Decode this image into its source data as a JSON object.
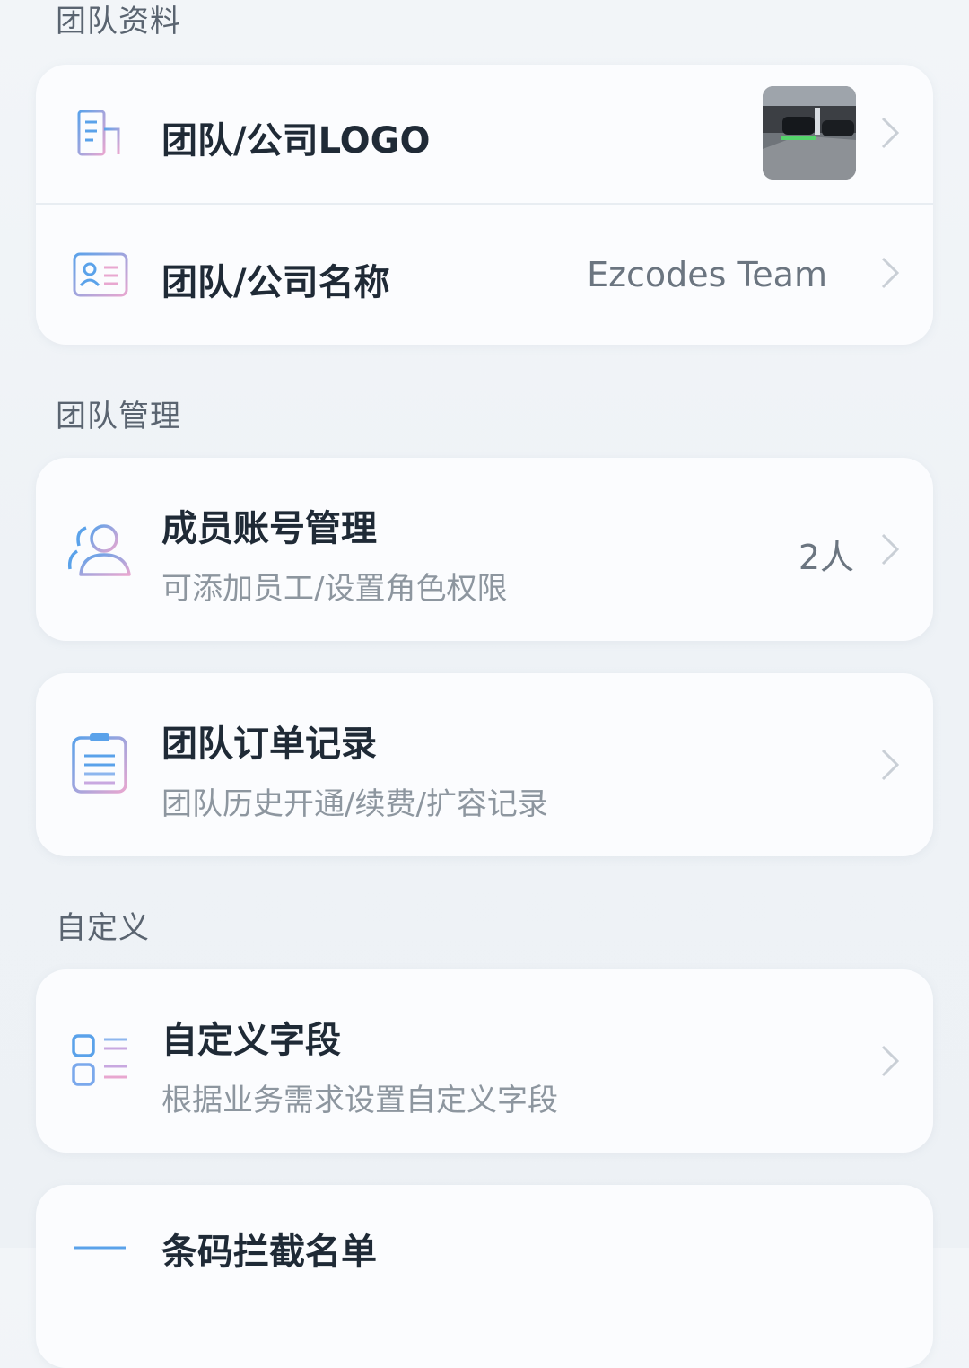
{
  "sections": {
    "profile_title": "团队资料",
    "management_title": "团队管理",
    "custom_title": "自定义"
  },
  "profile": {
    "logo": {
      "label": "团队/公司LOGO",
      "icon": "building-icon"
    },
    "name": {
      "label": "团队/公司名称",
      "value": "Ezcodes Team",
      "icon": "id-card-icon"
    }
  },
  "management": {
    "members": {
      "label": "成员账号管理",
      "sub": "可添加员工/设置角色权限",
      "value": "2人",
      "icon": "users-icon"
    },
    "orders": {
      "label": "团队订单记录",
      "sub": "团队历史开通/续费/扩容记录",
      "icon": "clipboard-icon"
    }
  },
  "custom": {
    "fields": {
      "label": "自定义字段",
      "sub": "根据业务需求设置自定义字段",
      "icon": "list-fields-icon"
    },
    "barcode": {
      "label": "条码拦截名单"
    }
  },
  "colors": {
    "icon_blue": "#5aa2ea",
    "icon_pink": "#e8a7d0",
    "chevron": "#c9cfd6"
  }
}
